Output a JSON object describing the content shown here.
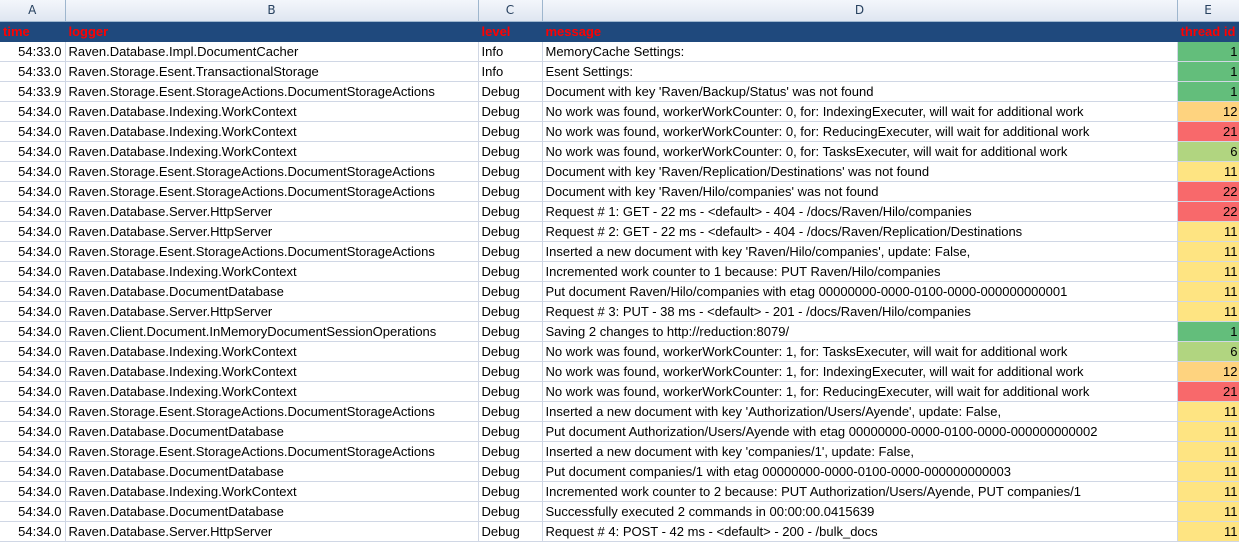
{
  "columns": [
    "A",
    "B",
    "C",
    "D",
    "E"
  ],
  "header": {
    "time": "time",
    "logger": "logger",
    "level": "level",
    "message": "message",
    "thread": "thread id"
  },
  "rows": [
    {
      "time": "54:33.0",
      "logger": "Raven.Database.Impl.DocumentCacher",
      "level": "Info",
      "message": "MemoryCache Settings:",
      "thread": "1",
      "color": "#63be7b"
    },
    {
      "time": "54:33.0",
      "logger": "Raven.Storage.Esent.TransactionalStorage",
      "level": "Info",
      "message": "Esent Settings:",
      "thread": "1",
      "color": "#63be7b"
    },
    {
      "time": "54:33.9",
      "logger": "Raven.Storage.Esent.StorageActions.DocumentStorageActions",
      "level": "Debug",
      "message": "Document with key 'Raven/Backup/Status' was not found",
      "thread": "1",
      "color": "#63be7b"
    },
    {
      "time": "54:34.0",
      "logger": "Raven.Database.Indexing.WorkContext",
      "level": "Debug",
      "message": "No work was found, workerWorkCounter: 0, for: IndexingExecuter, will wait for additional work",
      "thread": "12",
      "color": "#fed37f"
    },
    {
      "time": "54:34.0",
      "logger": "Raven.Database.Indexing.WorkContext",
      "level": "Debug",
      "message": "No work was found, workerWorkCounter: 0, for: ReducingExecuter, will wait for additional work",
      "thread": "21",
      "color": "#f8696b"
    },
    {
      "time": "54:34.0",
      "logger": "Raven.Database.Indexing.WorkContext",
      "level": "Debug",
      "message": "No work was found, workerWorkCounter: 0, for: TasksExecuter, will wait for additional work",
      "thread": "6",
      "color": "#b1d580"
    },
    {
      "time": "54:34.0",
      "logger": "Raven.Storage.Esent.StorageActions.DocumentStorageActions",
      "level": "Debug",
      "message": "Document with key 'Raven/Replication/Destinations' was not found",
      "thread": "11",
      "color": "#fee482"
    },
    {
      "time": "54:34.0",
      "logger": "Raven.Storage.Esent.StorageActions.DocumentStorageActions",
      "level": "Debug",
      "message": "Document with key 'Raven/Hilo/companies' was not found",
      "thread": "22",
      "color": "#f8696b"
    },
    {
      "time": "54:34.0",
      "logger": "Raven.Database.Server.HttpServer",
      "level": "Debug",
      "message": "Request #   1: GET     -    22 ms - <default>  - 404 - /docs/Raven/Hilo/companies",
      "thread": "22",
      "color": "#f8696b"
    },
    {
      "time": "54:34.0",
      "logger": "Raven.Database.Server.HttpServer",
      "level": "Debug",
      "message": "Request #   2: GET     -    22 ms - <default>  - 404 - /docs/Raven/Replication/Destinations",
      "thread": "11",
      "color": "#fee482"
    },
    {
      "time": "54:34.0",
      "logger": "Raven.Storage.Esent.StorageActions.DocumentStorageActions",
      "level": "Debug",
      "message": "Inserted a new document with key 'Raven/Hilo/companies', update: False,",
      "thread": "11",
      "color": "#fee482"
    },
    {
      "time": "54:34.0",
      "logger": "Raven.Database.Indexing.WorkContext",
      "level": "Debug",
      "message": "Incremented work counter to 1 because: PUT Raven/Hilo/companies",
      "thread": "11",
      "color": "#fee482"
    },
    {
      "time": "54:34.0",
      "logger": "Raven.Database.DocumentDatabase",
      "level": "Debug",
      "message": "Put document Raven/Hilo/companies with etag 00000000-0000-0100-0000-000000000001",
      "thread": "11",
      "color": "#fee482"
    },
    {
      "time": "54:34.0",
      "logger": "Raven.Database.Server.HttpServer",
      "level": "Debug",
      "message": "Request #   3: PUT     -    38 ms - <default>  - 201 - /docs/Raven/Hilo/companies",
      "thread": "11",
      "color": "#fee482"
    },
    {
      "time": "54:34.0",
      "logger": "Raven.Client.Document.InMemoryDocumentSessionOperations",
      "level": "Debug",
      "message": "Saving 2 changes to http://reduction:8079/",
      "thread": "1",
      "color": "#63be7b"
    },
    {
      "time": "54:34.0",
      "logger": "Raven.Database.Indexing.WorkContext",
      "level": "Debug",
      "message": "No work was found, workerWorkCounter: 1, for: TasksExecuter, will wait for additional work",
      "thread": "6",
      "color": "#b1d580"
    },
    {
      "time": "54:34.0",
      "logger": "Raven.Database.Indexing.WorkContext",
      "level": "Debug",
      "message": "No work was found, workerWorkCounter: 1, for: IndexingExecuter, will wait for additional work",
      "thread": "12",
      "color": "#fed37f"
    },
    {
      "time": "54:34.0",
      "logger": "Raven.Database.Indexing.WorkContext",
      "level": "Debug",
      "message": "No work was found, workerWorkCounter: 1, for: ReducingExecuter, will wait for additional work",
      "thread": "21",
      "color": "#f8696b"
    },
    {
      "time": "54:34.0",
      "logger": "Raven.Storage.Esent.StorageActions.DocumentStorageActions",
      "level": "Debug",
      "message": "Inserted a new document with key 'Authorization/Users/Ayende', update: False,",
      "thread": "11",
      "color": "#fee482"
    },
    {
      "time": "54:34.0",
      "logger": "Raven.Database.DocumentDatabase",
      "level": "Debug",
      "message": "Put document Authorization/Users/Ayende with etag 00000000-0000-0100-0000-000000000002",
      "thread": "11",
      "color": "#fee482"
    },
    {
      "time": "54:34.0",
      "logger": "Raven.Storage.Esent.StorageActions.DocumentStorageActions",
      "level": "Debug",
      "message": "Inserted a new document with key 'companies/1', update: False,",
      "thread": "11",
      "color": "#fee482"
    },
    {
      "time": "54:34.0",
      "logger": "Raven.Database.DocumentDatabase",
      "level": "Debug",
      "message": "Put document companies/1 with etag 00000000-0000-0100-0000-000000000003",
      "thread": "11",
      "color": "#fee482"
    },
    {
      "time": "54:34.0",
      "logger": "Raven.Database.Indexing.WorkContext",
      "level": "Debug",
      "message": "Incremented work counter to 2 because: PUT Authorization/Users/Ayende, PUT companies/1",
      "thread": "11",
      "color": "#fee482"
    },
    {
      "time": "54:34.0",
      "logger": "Raven.Database.DocumentDatabase",
      "level": "Debug",
      "message": "Successfully executed 2 commands in 00:00:00.0415639",
      "thread": "11",
      "color": "#fee482"
    },
    {
      "time": "54:34.0",
      "logger": "Raven.Database.Server.HttpServer",
      "level": "Debug",
      "message": "Request #   4: POST    -    42 ms - <default>  - 200 - /bulk_docs",
      "thread": "11",
      "color": "#fee482"
    }
  ]
}
